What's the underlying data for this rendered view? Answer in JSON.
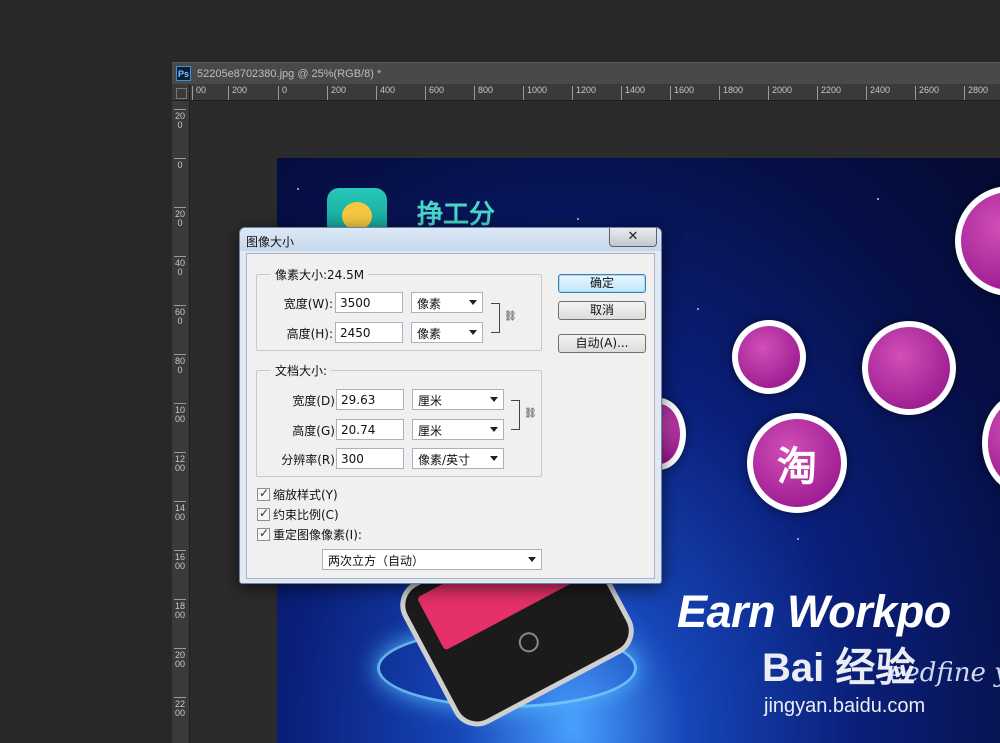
{
  "document": {
    "tab_title": "52205e8702380.jpg @ 25%(RGB/8) *",
    "app_icon": "Ps"
  },
  "ruler": {
    "horizontal": [
      "00",
      "200",
      "0",
      "200",
      "400",
      "600",
      "800",
      "1000",
      "1200",
      "1400",
      "1600",
      "1800",
      "2000",
      "2200",
      "2400",
      "2600",
      "2800"
    ],
    "vertical": [
      "200",
      "0",
      "200",
      "400",
      "600",
      "800",
      "1000",
      "1200",
      "1400",
      "1600",
      "1800",
      "2000",
      "2200"
    ]
  },
  "artwork": {
    "app_name": "挣工分",
    "headline": "Earn Workpo",
    "circle_char": "淘",
    "watermark_logo": "Bai 经验",
    "watermark_script": "eedfine y",
    "watermark_url": "jingyan.baidu.com"
  },
  "dialog": {
    "title": "图像大小",
    "close_glyph": "✕",
    "pixel_group": {
      "legend": "像素大小:24.5M",
      "width_label": "宽度(W):",
      "width_value": "3500",
      "width_unit": "像素",
      "height_label": "高度(H):",
      "height_value": "2450",
      "height_unit": "像素"
    },
    "doc_group": {
      "legend": "文档大小:",
      "width_label": "宽度(D):",
      "width_value": "29.63",
      "width_unit": "厘米",
      "height_label": "高度(G):",
      "height_value": "20.74",
      "height_unit": "厘米",
      "res_label": "分辨率(R):",
      "res_value": "300",
      "res_unit": "像素/英寸"
    },
    "buttons": {
      "ok": "确定",
      "cancel": "取消",
      "auto": "自动(A)..."
    },
    "options": {
      "scale_styles": "缩放样式(Y)",
      "constrain": "约束比例(C)",
      "resample": "重定图像像素(I):",
      "resample_method": "两次立方（自动）"
    }
  }
}
